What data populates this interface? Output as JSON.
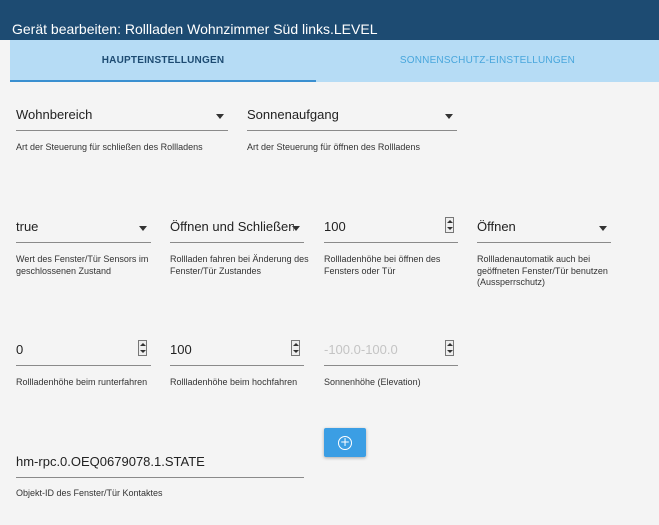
{
  "dialog": {
    "title": "Gerät bearbeiten: Rollladen Wohnzimmer Süd links.LEVEL"
  },
  "tabs": [
    {
      "label": "HAUPTEINSTELLUNGEN",
      "active": true
    },
    {
      "label": "SONNENSCHUTZ-EINSTELLUNGEN",
      "active": false
    }
  ],
  "fields": {
    "close_control": {
      "value": "Wohnbereich",
      "help": "Art der Steuerung für schließen des Rollladens"
    },
    "open_control": {
      "value": "Sonnenaufgang",
      "help": "Art der Steuerung für öffnen des Rollladens"
    },
    "window_closed_value": {
      "value": "true",
      "help": "Wert des Fenster/Tür Sensors im geschlossenen Zustand"
    },
    "on_window_change": {
      "value": "Öffnen und Schließen",
      "help": "Rollladen fahren bei Änderung des Fenster/Tür Zustandes"
    },
    "height_window_open": {
      "value": "100",
      "help": "Rollladenhöhe bei öffnen des Fensters oder Tür"
    },
    "lockout_protection": {
      "value": "Öffnen",
      "help": "Rollladenautomatik auch bei geöffneten Fenster/Tür benutzen (Aussperrschutz)"
    },
    "height_down": {
      "value": "0",
      "help": "Rollladenhöhe beim runterfahren"
    },
    "height_up": {
      "value": "100",
      "help": "Rollladenhöhe beim hochfahren"
    },
    "sun_elevation": {
      "placeholder": "-100.0-100.0",
      "help": "Sonnenhöhe (Elevation)"
    },
    "window_object_id": {
      "value": "hm-rpc.0.OEQ0679078.1.STATE",
      "help": "Objekt-ID des Fenster/Tür Kontaktes"
    }
  },
  "icons": {
    "add": "add-circle-icon",
    "dropdown": "chevron-down-icon",
    "stepper": "number-stepper-icon"
  },
  "colors": {
    "titlebar": "#1d4b72",
    "tabbar": "#b6dcf5",
    "accent": "#3b9ee4"
  }
}
